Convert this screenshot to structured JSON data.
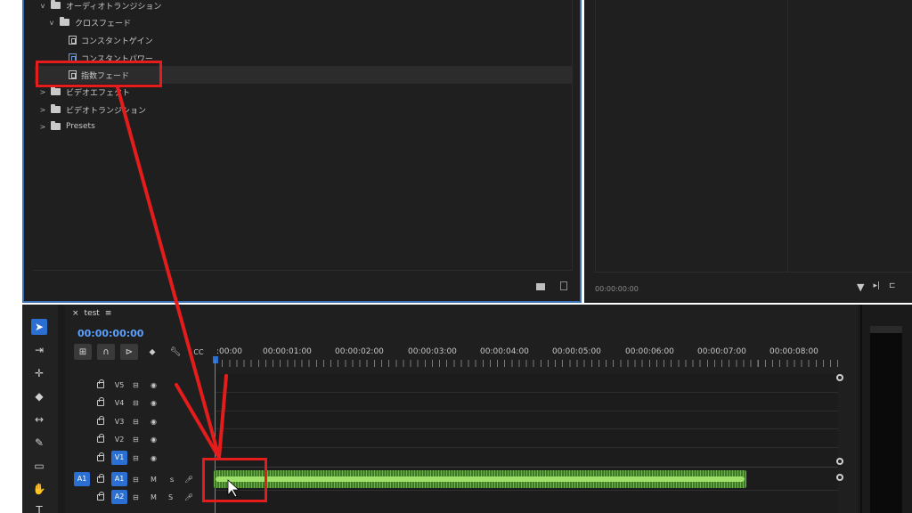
{
  "effects_tree": {
    "items": [
      {
        "label": "オーディオトランジション",
        "chevron": "v",
        "type": "folder"
      },
      {
        "label": "クロスフェード",
        "chevron": "v",
        "type": "folder"
      },
      {
        "label": "コンスタントゲイン",
        "type": "effect"
      },
      {
        "label": "コンスタントパワー",
        "type": "effect"
      },
      {
        "label": "指数フェード",
        "type": "effect",
        "selected": true
      },
      {
        "label": "ビデオエフェクト",
        "chevron": ">",
        "type": "folder"
      },
      {
        "label": "ビデオトランジション",
        "chevron": ">",
        "type": "folder"
      },
      {
        "label": "Presets",
        "chevron": ">",
        "type": "folder"
      }
    ]
  },
  "program": {
    "timecode": "00:00:00:00"
  },
  "timeline": {
    "sequence_name": "test",
    "close_glyph": "×",
    "menu_glyph": "≡",
    "timecode": "00:00:00:00",
    "ruler_labels": [
      ":00:00",
      "00:00:01:00",
      "00:00:02:00",
      "00:00:03:00",
      "00:00:04:00",
      "00:00:05:00",
      "00:00:06:00",
      "00:00:07:00",
      "00:00:08:00"
    ],
    "video_tracks": [
      {
        "name": "V5",
        "targeted": false
      },
      {
        "name": "V4",
        "targeted": false
      },
      {
        "name": "V3",
        "targeted": false
      },
      {
        "name": "V2",
        "targeted": false
      },
      {
        "name": "V1",
        "targeted": true
      }
    ],
    "audio_tracks": [
      {
        "name": "A1",
        "source": "A1",
        "mute": "M",
        "solo": "S"
      },
      {
        "name": "A2",
        "source": "",
        "mute": "M",
        "solo": "S"
      }
    ]
  },
  "colors": {
    "accent_blue": "#2a6fd1",
    "annotation_red": "#e51c1c",
    "audio_clip_green": "#3c7a26"
  }
}
